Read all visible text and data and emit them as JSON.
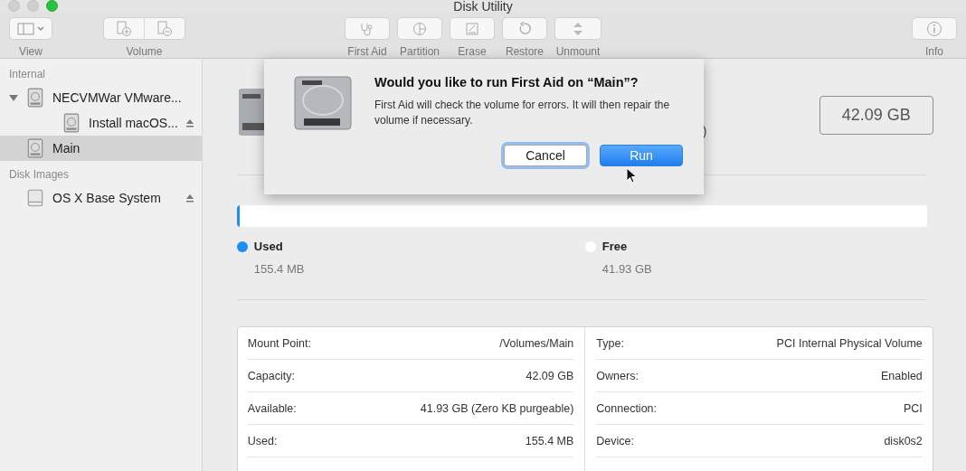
{
  "window": {
    "title": "Disk Utility"
  },
  "toolbar": [
    {
      "label": "View",
      "buttons": [
        {
          "kind": "sidebar"
        }
      ]
    },
    {
      "label": "Volume",
      "buttons": [
        {
          "kind": "add"
        },
        {
          "kind": "remove"
        }
      ]
    },
    {
      "label": "First Aid",
      "buttons": [
        {
          "kind": "stethoscope"
        }
      ]
    },
    {
      "label": "Partition",
      "buttons": [
        {
          "kind": "partition"
        }
      ]
    },
    {
      "label": "Erase",
      "buttons": [
        {
          "kind": "erase"
        }
      ]
    },
    {
      "label": "Restore",
      "buttons": [
        {
          "kind": "restore"
        }
      ]
    },
    {
      "label": "Unmount",
      "buttons": [
        {
          "kind": "unmount"
        }
      ]
    },
    {
      "label": "Info",
      "buttons": [
        {
          "kind": "info"
        }
      ]
    }
  ],
  "sidebar": {
    "sections": [
      {
        "title": "Internal",
        "items": [
          {
            "name": "NECVMWar VMware...",
            "kind": "disk",
            "expanded": true,
            "selected": false,
            "children": [
              {
                "name": "Install macOS...",
                "kind": "disk",
                "selected": false,
                "eject": true
              }
            ]
          },
          {
            "name": "Main",
            "kind": "disk",
            "selected": true
          }
        ]
      },
      {
        "title": "Disk Images",
        "items": [
          {
            "name": "OS X Base System",
            "kind": "image",
            "selected": false,
            "eject": true
          }
        ]
      }
    ]
  },
  "header": {
    "fragment": ")",
    "capacity": "42.09 GB"
  },
  "usage": {
    "level": 0.004,
    "legend": [
      {
        "label": "Used",
        "value": "155.4 MB",
        "color": "#1e8cf5"
      },
      {
        "label": "Free",
        "value": "41.93 GB",
        "color": "#ffffff"
      }
    ]
  },
  "info": [
    [
      {
        "label": "Mount Point:",
        "value": "/Volumes/Main"
      },
      {
        "label": "Capacity:",
        "value": "42.09 GB"
      },
      {
        "label": "Available:",
        "value": "41.93 GB (Zero KB purgeable)"
      },
      {
        "label": "Used:",
        "value": "155.4 MB"
      }
    ],
    [
      {
        "label": "Type:",
        "value": "PCI Internal Physical Volume"
      },
      {
        "label": "Owners:",
        "value": "Enabled"
      },
      {
        "label": "Connection:",
        "value": "PCI"
      },
      {
        "label": "Device:",
        "value": "disk0s2"
      }
    ]
  ],
  "dialog": {
    "title": "Would you like to run First Aid on “Main”?",
    "message": "First Aid will check the volume for errors. It will then repair the volume if necessary.",
    "buttons": [
      {
        "label": "Cancel",
        "kind": "cancel"
      },
      {
        "label": "Run",
        "kind": "default"
      }
    ]
  }
}
